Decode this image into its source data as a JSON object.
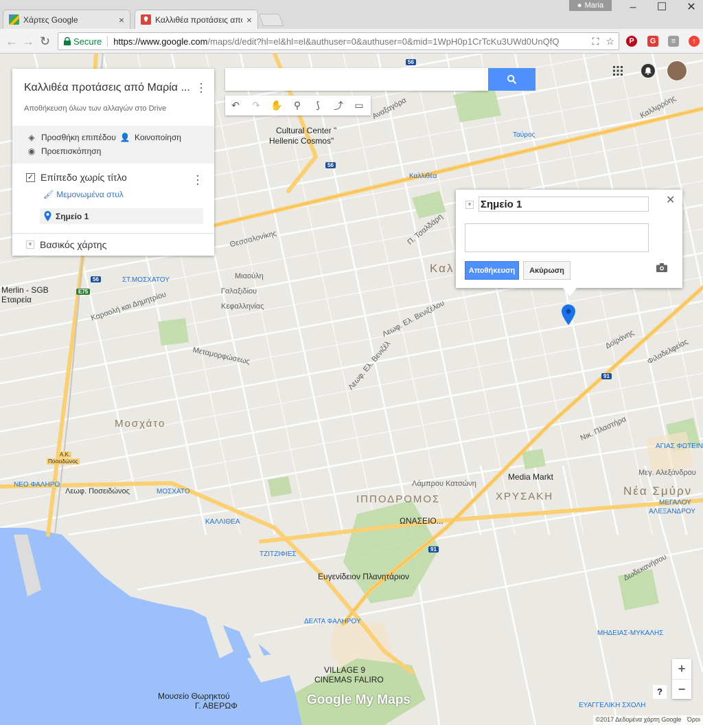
{
  "browser": {
    "tabs": [
      {
        "title": "Χάρτες Google",
        "close": "×"
      },
      {
        "title": "Καλλιθέα προτάσεις απο",
        "close": "×"
      }
    ],
    "user": "Maria",
    "secure_label": "Secure",
    "url_host": "https://www.google.com",
    "url_rest": "/maps/d/edit?hl=el&hl=el&authuser=0&authuser=0&mid=1WpH0p1CrTcKu3UWd0UnQfQ"
  },
  "panel": {
    "title": "Καλλιθέα προτάσεις από Μαρία ...",
    "subtitle": "Αποθήκευση όλων των αλλαγών στο Drive",
    "add_layer": "Προσθήκη επιπέδου",
    "share": "Κοινοποίηση",
    "preview": "Προεπισκόπηση",
    "layer_name": "Επίπεδο χωρίς τίτλο",
    "style_link": "Μεμονωμένα στυλ",
    "item_name": "Σημείο 1",
    "base_map": "Βασικός χάρτης"
  },
  "search": {
    "placeholder": ""
  },
  "popup": {
    "name": "Σημείο 1",
    "description": "",
    "save": "Αποθήκευση",
    "cancel": "Ακύρωση"
  },
  "map_labels": {
    "cultural_center_1": "Cultural Center \"",
    "cultural_center_2": "Hellenic Cosmos\"",
    "tavros": "Ταύρος",
    "kallithea_metro": "Καλλιθέα",
    "kallithea_area": "Καλ",
    "st_moschatou": "ΣΤ.ΜΟΣΧΑΤΟΥ",
    "merlin": "Merlin - SGB",
    "etaireia": "Εταιρεία",
    "moschato": "Μοσχάτο",
    "neo_faliro": "ΝΕΟ ΦΑΛΗΡΟ",
    "posidonos": "Λεωφ. Ποσειδώνος",
    "moschato_metro": "ΜΟΣΧΑΤΟ",
    "kallithea_station": "ΚΑΛΛΙΘΕΑ",
    "tzitzifies": "ΤΖΙΤΖΙΦΙΕΣ",
    "ippodromos": "ΙΠΠΟΔΡΟΜΟΣ",
    "onaseio": "ΩΝΑΣΕΙΟ...",
    "chrysaki": "ΧΡΥΣΑΚΗ",
    "media_markt": "Media Markt",
    "nea_smyrni": "Νέα Σμύρν",
    "eugenideio": "Ευγενίδειον Πλανητάριον",
    "delta_falirou": "ΔΕΛΤΑ ΦΑΛΗΡΟΥ",
    "village_1": "VILLAGE 9",
    "village_2": "CINEMAS FALIRO",
    "mouseio_1": "Μουσείο Θωρηκτού",
    "mouseio_2": "Γ. ΑΒΕΡΩΦ",
    "megalou_1": "ΜΕΓΑΛΟΥ",
    "megalou_2": "ΑΛΕΞΑΝΔΡΟΥ",
    "agias_foteinis": "ΑΓΙΑΣ ΦΩΤΕΙΝΗ",
    "mideias": "ΜΗΔΕΙΑΣ-ΜΥΚΑΛΗΣ",
    "evaggeliki": "ΕΥΑΓΓΕΛΙΚΗ ΣΧΟΛΗ",
    "ak_posidonos": "Α.Κ.",
    "ak_posidonos_2": "Ποσειδώνος",
    "thessalonikis": "Θεσσαλονίκης",
    "leof_venizelou": "Λεωφ. Ελ. Βενιζέλου",
    "syggrou": "Λεωφ. Ελ. Βενιζέλ",
    "metamorfoseos": "Μεταμορφώσεως",
    "karaoli": "Καραολή και Δημητρίου",
    "lampros": "Λάμπρου Κατσώνη",
    "kefallinias": "Κεφαλληνίας",
    "galaxidiou": "Γαλαξιδίου",
    "pl_taxdari": "Π. Τσαλδάρη",
    "kallirrois": "Καλλιρρόης",
    "dorilaiou": "Δωδεκανήσου",
    "doiranis": "Δοϊράνης",
    "meg_alexandrou": "Μεγ. Αλεξάνδρου",
    "nik_plastira": "Νικ. Πλαστήρα",
    "filadelfeias": "Φιλαδελφείας",
    "mpotasi": "Μιαούλη",
    "anagnostopoulou": "Αναξαγόρα",
    "road_56": "56",
    "road_91": "91",
    "road_e75": "E75"
  },
  "brand": {
    "google_my_maps": "Google My Maps"
  },
  "footer": {
    "copyright": "©2017 Δεδομένα χάρτη Google",
    "terms": "Όροι"
  },
  "colors": {
    "accent": "#4d90fe",
    "pin": "#1a73e8",
    "water": "#9cc0f9",
    "park": "#c0dba8",
    "arterial": "#fad072"
  }
}
